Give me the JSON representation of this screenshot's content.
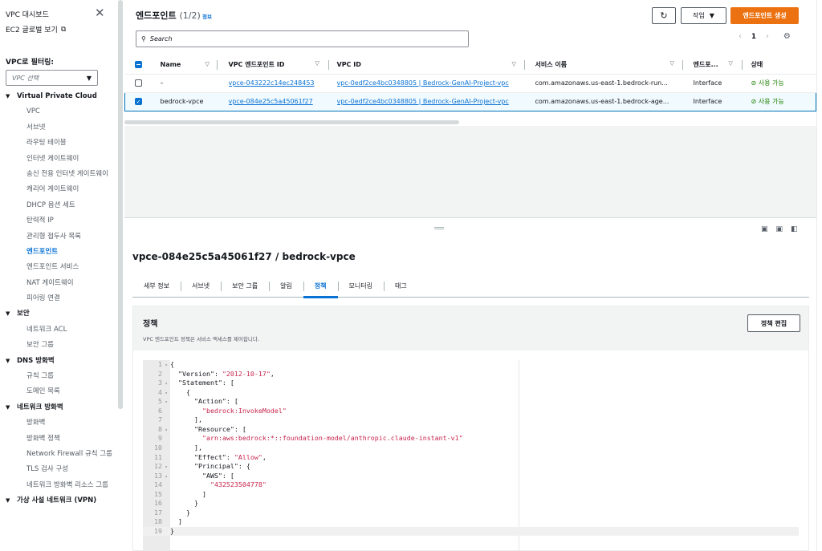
{
  "sidebar": {
    "dashboard": "VPC 대시보드",
    "ec2_global": "EC2 글로벌 보기",
    "filter_label": "VPC로 필터링:",
    "filter_placeholder": "VPC 선택",
    "items": [
      {
        "type": "section",
        "label": "Virtual Private Cloud"
      },
      {
        "type": "item",
        "label": "VPC"
      },
      {
        "type": "item",
        "label": "서브넷"
      },
      {
        "type": "item",
        "label": "라우팅 테이블"
      },
      {
        "type": "item",
        "label": "인터넷 게이트웨이"
      },
      {
        "type": "item",
        "label": "송신 전용 인터넷 게이트웨이"
      },
      {
        "type": "item",
        "label": "캐리어 게이트웨이"
      },
      {
        "type": "item",
        "label": "DHCP 옵션 세트"
      },
      {
        "type": "item",
        "label": "탄력적 IP"
      },
      {
        "type": "item",
        "label": "관리형 접두사 목록"
      },
      {
        "type": "item",
        "label": "엔드포인트",
        "active": true
      },
      {
        "type": "item",
        "label": "엔드포인트 서비스"
      },
      {
        "type": "item",
        "label": "NAT 게이트웨이"
      },
      {
        "type": "item",
        "label": "피어링 연결"
      },
      {
        "type": "section",
        "label": "보안"
      },
      {
        "type": "item",
        "label": "네트워크 ACL"
      },
      {
        "type": "item",
        "label": "보안 그룹"
      },
      {
        "type": "section",
        "label": "DNS 방화벽"
      },
      {
        "type": "item",
        "label": "규칙 그룹"
      },
      {
        "type": "item",
        "label": "도메인 목록"
      },
      {
        "type": "section",
        "label": "네트워크 방화벽"
      },
      {
        "type": "item",
        "label": "방화벽"
      },
      {
        "type": "item",
        "label": "방화벽 정책"
      },
      {
        "type": "item",
        "label": "Network Firewall 규칙 그룹"
      },
      {
        "type": "item",
        "label": "TLS 검사 구성"
      },
      {
        "type": "item",
        "label": "네트워크 방화벽 리소스 그룹"
      },
      {
        "type": "section",
        "label": "가상 사설 네트워크 (VPN)"
      }
    ]
  },
  "header": {
    "title": "엔드포인트",
    "count": "(1/2)",
    "info": "정보",
    "action_label": "작업",
    "create_label": "엔드포인트 생성",
    "search_placeholder": "Search",
    "page": "1"
  },
  "table": {
    "columns": [
      "Name",
      "VPC 엔드포인트 ID",
      "VPC ID",
      "서비스 이름",
      "엔드포...",
      "상태"
    ],
    "rows": [
      {
        "name": "–",
        "endpoint_id": "vpce-043222c14ec248453",
        "vpc_id": "vpc-0edf2ce4bc0348805 | Bedrock-GenAI-Project-vpc",
        "service": "com.amazonaws.us-east-1.bedrock-run...",
        "type": "Interface",
        "status": "사용 가능",
        "selected": false
      },
      {
        "name": "bedrock-vpce",
        "endpoint_id": "vpce-084e25c5a45061f27",
        "vpc_id": "vpc-0edf2ce4bc0348805 | Bedrock-GenAI-Project-vpc",
        "service": "com.amazonaws.us-east-1.bedrock-age...",
        "type": "Interface",
        "status": "사용 가능",
        "selected": true
      }
    ]
  },
  "detail": {
    "title": "vpce-084e25c5a45061f27 / bedrock-vpce",
    "tabs": [
      "세부 정보",
      "서브넷",
      "보안 그룹",
      "알림",
      "정책",
      "모니터링",
      "태그"
    ],
    "active_tab": "정책",
    "policy_title": "정책",
    "policy_desc": "VPC 엔드포인트 정책은 서비스 액세스를 제어합니다.",
    "edit_label": "정책 편집",
    "code_lines": [
      {
        "n": "1",
        "f": "▾",
        "t": "{"
      },
      {
        "n": "2",
        "f": "",
        "t": "  \"Version\": ",
        "s": "\"2012-10-17\"",
        "e": ","
      },
      {
        "n": "3",
        "f": "▾",
        "t": "  \"Statement\": ["
      },
      {
        "n": "4",
        "f": "▾",
        "t": "    {"
      },
      {
        "n": "5",
        "f": "▾",
        "t": "      \"Action\": ["
      },
      {
        "n": "6",
        "f": "",
        "t": "        ",
        "s": "\"bedrock:InvokeModel\"",
        "e": ""
      },
      {
        "n": "7",
        "f": "",
        "t": "      ],"
      },
      {
        "n": "8",
        "f": "▾",
        "t": "      \"Resource\": ["
      },
      {
        "n": "9",
        "f": "",
        "t": "        ",
        "s": "\"arn:aws:bedrock:*::foundation-model/anthropic.claude-instant-v1\"",
        "e": ""
      },
      {
        "n": "10",
        "f": "",
        "t": "      ],"
      },
      {
        "n": "11",
        "f": "",
        "t": "      \"Effect\": ",
        "s": "\"Allow\"",
        "e": ","
      },
      {
        "n": "12",
        "f": "▾",
        "t": "      \"Principal\": {"
      },
      {
        "n": "13",
        "f": "▾",
        "t": "        \"AWS\": ["
      },
      {
        "n": "14",
        "f": "",
        "t": "          ",
        "s": "\"432523504778\"",
        "e": ""
      },
      {
        "n": "15",
        "f": "",
        "t": "        ]"
      },
      {
        "n": "16",
        "f": "",
        "t": "      }"
      },
      {
        "n": "17",
        "f": "",
        "t": "    }"
      },
      {
        "n": "18",
        "f": "",
        "t": "  ]"
      },
      {
        "n": "19",
        "f": "",
        "t": "}"
      }
    ]
  },
  "colors": {
    "accent": "#0972d3",
    "primary": "#ec7211",
    "success": "#1d8102"
  }
}
